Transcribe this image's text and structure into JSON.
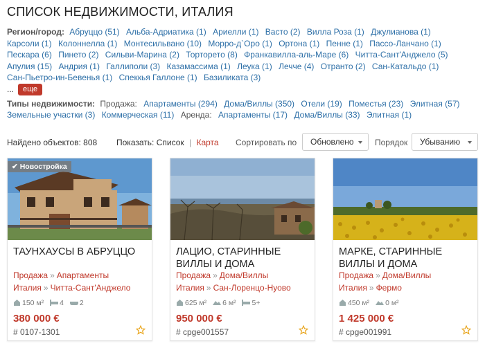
{
  "page_title": "СПИСОК НЕДВИЖИМОСТИ, ИТАЛИЯ",
  "filters": {
    "region_label": "Регион/город:",
    "regions": [
      "Абруццо (51)",
      "Альба-Адриатика (1)",
      "Ариелли (1)",
      "Васто (2)",
      "Вилла Роза (1)",
      "Джулианова (1)",
      "Карсоли (1)",
      "Колоннелла (1)",
      "Монтесильвано (10)",
      "Морро-д`Оро (1)",
      "Ортона (1)",
      "Пенне (1)",
      "Пассо-Ланчано (1)",
      "Пескара (6)",
      "Пинето (2)",
      "Сильви-Марина (2)",
      "Торторето (8)",
      "Франкавилла-аль-Маре (6)",
      "Читта-Сант'Анджело (5)",
      "Апулия (15)",
      "Андрия (1)",
      "Галлиполи (3)",
      "Казамассима (1)",
      "Леука (1)",
      "Лечче (4)",
      "Отранто (2)",
      "Сан-Катальдо (1)",
      "Сан-Пьетро-ин-Бевенья (1)",
      "Спеккья Галлоне (1)",
      "Базиликата (3)"
    ],
    "more_dots": "...",
    "more_label": "еще",
    "types_label": "Типы недвижимости:",
    "sale_label": "Продажа:",
    "sale_types": [
      "Апартаменты (294)",
      "Дома/Виллы (350)",
      "Отели (19)",
      "Поместья (23)",
      "Элитная (57)",
      "Земельные участки (3)",
      "Коммерческая (11)"
    ],
    "rent_label": "Аренда:",
    "rent_types": [
      "Апартаменты (17)",
      "Дома/Виллы (33)",
      "Элитная (1)"
    ]
  },
  "toolbar": {
    "found": "Найдено объектов: 808",
    "show_label": "Показать:",
    "show_list": "Список",
    "show_sep": "|",
    "show_map": "Карта",
    "sort_label": "Сортировать по",
    "sort_value": "Обновлено",
    "order_label": "Порядок",
    "order_value": "Убыванию"
  },
  "listings": [
    {
      "badge": "Новостройка",
      "title": "ТАУНХАУСЫ В АБРУЦЦО",
      "deal": "Продажа",
      "type": "Апартаменты",
      "country": "Италия",
      "city": "Читта-Сант'Анджело",
      "area": "150 м²",
      "bedrooms": "4",
      "bathrooms": "2",
      "price": "380 000 €",
      "ref": "# 0107-1301"
    },
    {
      "badge": "",
      "title": "ЛАЦИО, СТАРИННЫЕ ВИЛЛЫ И ДОМА",
      "deal": "Продажа",
      "type": "Дома/Виллы",
      "country": "Италия",
      "city": "Сан-Лоренцо-Нуово",
      "area": "625 м²",
      "bedrooms": "6 м²",
      "bathrooms": "5+",
      "price": "950 000 €",
      "ref": "# cpge001557"
    },
    {
      "badge": "",
      "title": "МАРКЕ, СТАРИННЫЕ ВИЛЛЫ И ДОМА",
      "deal": "Продажа",
      "type": "Дома/Виллы",
      "country": "Италия",
      "city": "Фермо",
      "area": "450 м²",
      "bedrooms": "0 м²",
      "bathrooms": "",
      "price": "1 425 000 €",
      "ref": "# cpge001991"
    }
  ],
  "colors": {
    "link": "#2d6fa7",
    "accent": "#c0392b"
  }
}
